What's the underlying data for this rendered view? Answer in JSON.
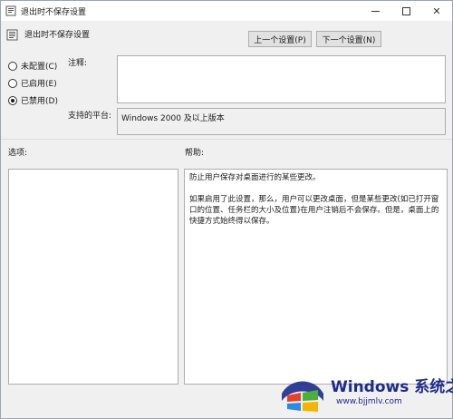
{
  "window": {
    "title": "退出时不保存设置",
    "minimize_icon": "minimize-icon",
    "maximize_icon": "maximize-icon",
    "close_glyph": "✕"
  },
  "header": {
    "policy_title": "退出时不保存设置",
    "prev_button": "上一个设置(P)",
    "next_button": "下一个设置(N)"
  },
  "state": {
    "options": [
      {
        "label": "未配置(C)",
        "selected": false
      },
      {
        "label": "已启用(E)",
        "selected": false
      },
      {
        "label": "已禁用(D)",
        "selected": true
      }
    ]
  },
  "comment": {
    "label": "注释:",
    "value": ""
  },
  "platform": {
    "label": "支持的平台:",
    "value": "Windows 2000 及以上版本"
  },
  "sections": {
    "options_label": "选项:",
    "help_label": "帮助:"
  },
  "help": {
    "paragraph1": "防止用户保存对桌面进行的某些更改。",
    "paragraph2": "如果启用了此设置，那么，用户可以更改桌面，但是某些更改(如已打开窗口的位置、任务栏的大小及位置)在用户注销后不会保存。但是，桌面上的快捷方式始终得以保存。"
  },
  "watermark": {
    "brand": "Windows 系统之家",
    "url": "www.bjjmlv.com"
  },
  "colors": {
    "window_bg": "#f0f0f0",
    "box_border": "#adadad",
    "watermark_blue": "#1d2b8c"
  }
}
